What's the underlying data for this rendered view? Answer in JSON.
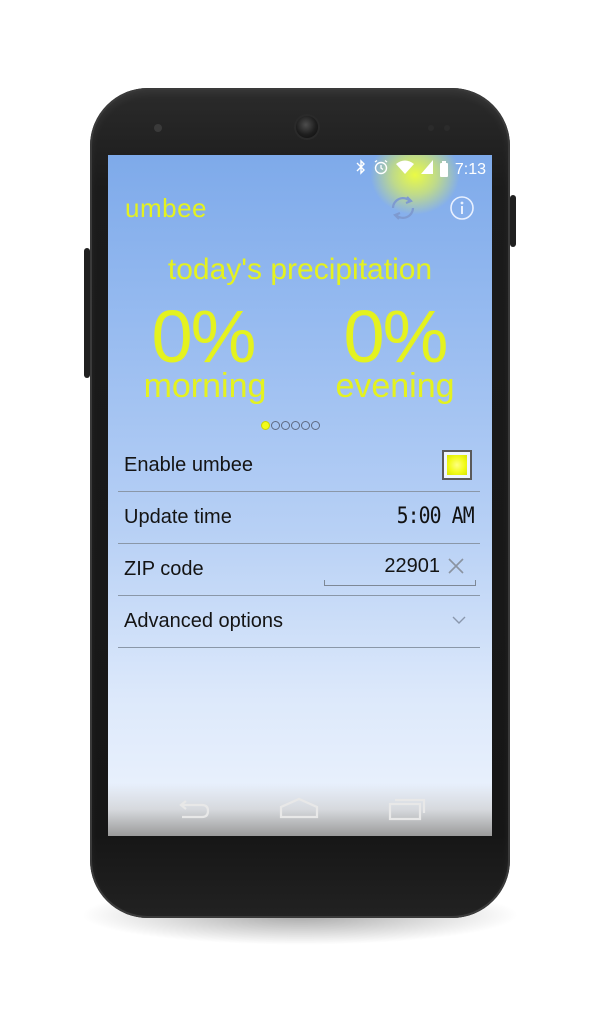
{
  "status_bar": {
    "time": "7:13",
    "icons": [
      "bluetooth-icon",
      "alarm-icon",
      "wifi-icon",
      "signal-icon",
      "battery-icon"
    ]
  },
  "action_bar": {
    "app_name": "umbee",
    "refresh_icon": "refresh-icon",
    "info_icon": "info-icon"
  },
  "precipitation": {
    "title": "today's precipitation",
    "morning": {
      "value": "0%",
      "label": "morning"
    },
    "evening": {
      "value": "0%",
      "label": "evening"
    },
    "pages": 6,
    "active_page": 1
  },
  "settings": {
    "enable": {
      "label": "Enable umbee",
      "checked": true
    },
    "update_time": {
      "label": "Update time",
      "value": "5:00 AM"
    },
    "zip": {
      "label": "ZIP code",
      "value": "22901"
    },
    "advanced": {
      "label": "Advanced options",
      "expanded": false
    }
  },
  "nav": {
    "back_icon": "back-icon",
    "home_icon": "home-icon",
    "recent_icon": "recent-apps-icon"
  },
  "colors": {
    "accent": "#e4f21f",
    "sky_top": "#7eaaea",
    "sky_bottom": "#eef4fd"
  }
}
